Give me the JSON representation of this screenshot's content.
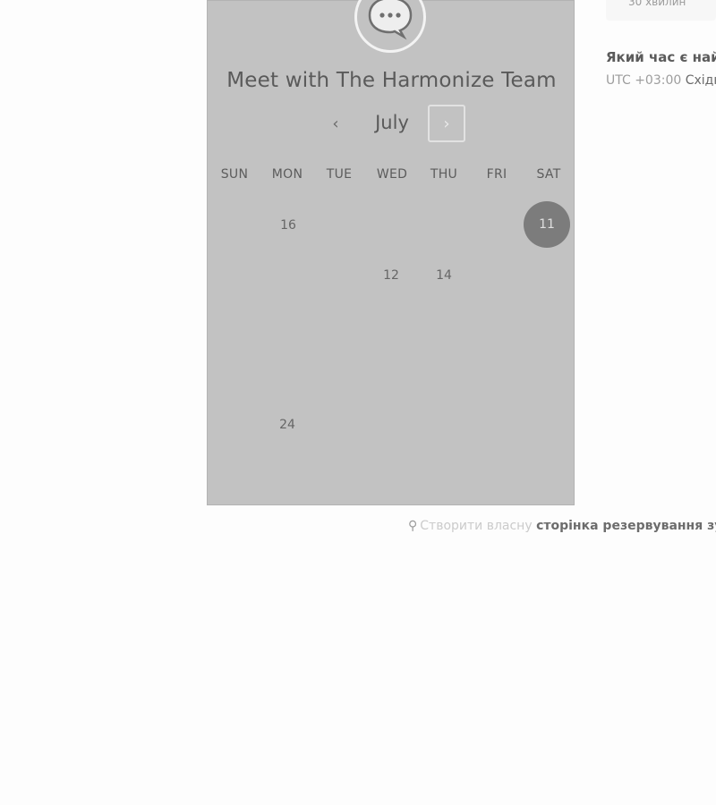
{
  "meeting": {
    "title": "Meet with The Harmonize Team",
    "month": "July",
    "weekdays": [
      "SUN",
      "MON",
      "TUE",
      "WED",
      "THU",
      "FRI",
      "SAT"
    ],
    "days": [
      "16",
      "11",
      "12",
      "14",
      "24"
    ],
    "selected_day": "11",
    "prev_icon": "‹",
    "next_icon": "›",
    "avatar_icon": "chat-bubble-icon"
  },
  "details": {
    "duration": "30 хвилин",
    "question": "Який час є найл",
    "tz_offset": "UTC +03:00",
    "tz_name": "Східн"
  },
  "footer": {
    "icon": "hubspot-sprocket-icon",
    "text": "Створити власну",
    "link": "сторінка резервування зустр"
  },
  "colors": {
    "panel": "#c2c2c2",
    "selected": "#7c7c7c",
    "background": "#fdfdfd"
  }
}
